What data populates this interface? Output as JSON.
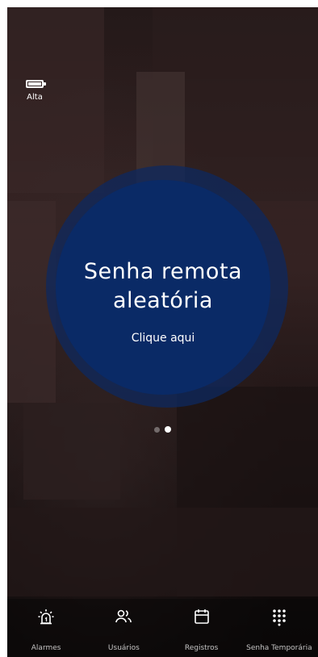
{
  "status": {
    "battery_label": "Alta"
  },
  "hero": {
    "title": "Senha remota aleatória",
    "cta": "Clique aqui",
    "circle_color": "#0a2a66"
  },
  "pager": {
    "pages": 2,
    "active_index": 1
  },
  "nav": {
    "items": [
      {
        "label": "Alarmes",
        "icon": "alarm-icon"
      },
      {
        "label": "Usuários",
        "icon": "users-icon"
      },
      {
        "label": "Registros",
        "icon": "calendar-icon"
      },
      {
        "label": "Senha Temporária",
        "icon": "keypad-icon"
      }
    ]
  }
}
